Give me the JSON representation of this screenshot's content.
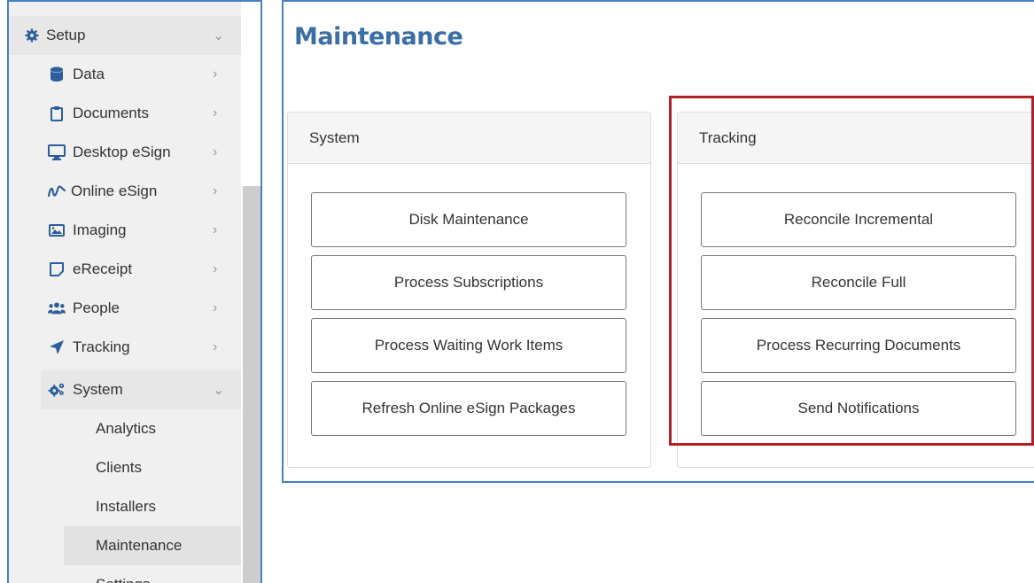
{
  "sidebar": {
    "setup": {
      "label": "Setup",
      "icon": "gear-icon"
    },
    "items": [
      {
        "label": "Data",
        "icon": "database-icon"
      },
      {
        "label": "Documents",
        "icon": "clipboard-icon"
      },
      {
        "label": "Desktop eSign",
        "icon": "monitor-icon"
      },
      {
        "label": "Online eSign",
        "icon": "signature-icon"
      },
      {
        "label": "Imaging",
        "icon": "image-icon"
      },
      {
        "label": "eReceipt",
        "icon": "receipt-icon"
      },
      {
        "label": "People",
        "icon": "people-icon"
      },
      {
        "label": "Tracking",
        "icon": "paper-plane-icon"
      }
    ],
    "system": {
      "label": "System",
      "icon": "gears-icon"
    },
    "system_children": [
      {
        "label": "Analytics"
      },
      {
        "label": "Clients"
      },
      {
        "label": "Installers"
      },
      {
        "label": "Maintenance"
      },
      {
        "label": "Settings"
      }
    ]
  },
  "main": {
    "title": "Maintenance",
    "system_panel": {
      "heading": "System",
      "buttons": [
        "Disk Maintenance",
        "Process Subscriptions",
        "Process Waiting Work Items",
        "Refresh Online eSign Packages"
      ]
    },
    "tracking_panel": {
      "heading": "Tracking",
      "buttons": [
        "Reconcile Incremental",
        "Reconcile Full",
        "Process Recurring Documents",
        "Send Notifications"
      ]
    }
  },
  "colors": {
    "title": "#3a6ea5",
    "frame_border": "#4a7fc1",
    "highlight": "#b21f24",
    "icon": "#2b5e9a"
  }
}
